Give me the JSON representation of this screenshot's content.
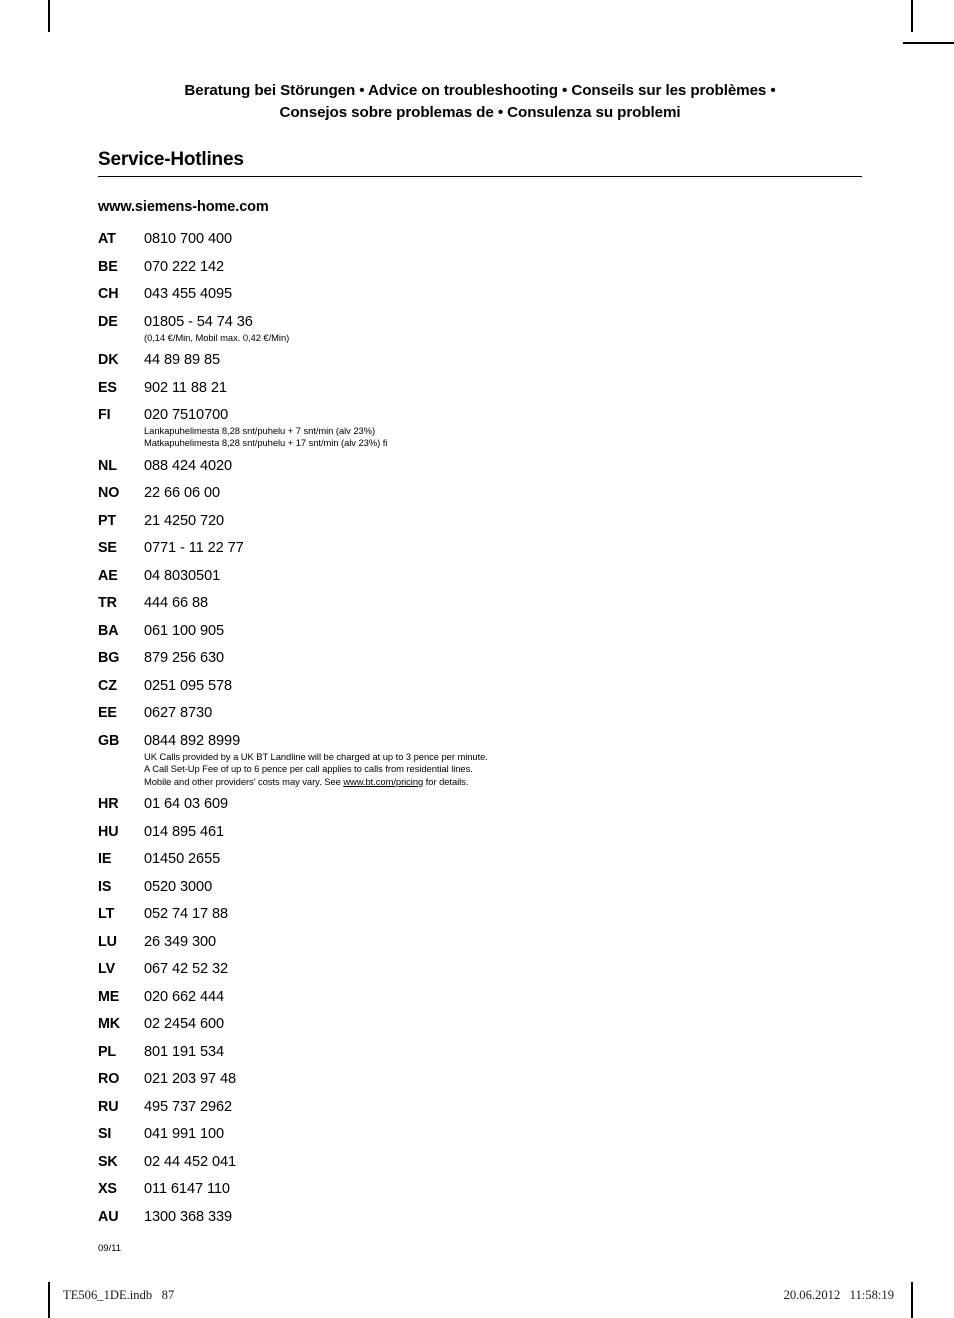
{
  "header": {
    "languages": [
      "Beratung bei Störungen",
      "Advice on troubleshooting",
      "Conseils sur les problèmes",
      "Consejos sobre problemas de",
      "Consulenza su problemi"
    ],
    "separator": "•",
    "line1": "Beratung bei Störungen  •  Advice on troubleshooting  •  Conseils sur les problèmes  •",
    "line2": "Consejos sobre problemas de  •  Consulenza su problemi"
  },
  "section": {
    "title": "Service-Hotlines",
    "website": "www.siemens-home.com"
  },
  "hotlines": [
    {
      "code": "AT",
      "number": "0810 700 400",
      "notes": []
    },
    {
      "code": "BE",
      "number": "070 222 142",
      "notes": []
    },
    {
      "code": "CH",
      "number": "043 455 4095",
      "notes": []
    },
    {
      "code": "DE",
      "number": "01805 - 54 74 36",
      "notes": [
        "(0,14 €/Min, Mobil max. 0,42 €/Min)"
      ]
    },
    {
      "code": "DK",
      "number": "44 89 89 85",
      "notes": []
    },
    {
      "code": "ES",
      "number": "902 11 88 21",
      "notes": []
    },
    {
      "code": "FI",
      "number": "020 7510700",
      "notes": [
        "Lankapuhelimesta 8,28 snt/puhelu + 7 snt/min (alv 23%)",
        "Matkapuhelimesta 8,28 snt/puhelu + 17 snt/min (alv 23%) fi"
      ]
    },
    {
      "code": "NL",
      "number": "088 424 4020",
      "notes": []
    },
    {
      "code": "NO",
      "number": "22 66 06 00",
      "notes": []
    },
    {
      "code": "PT",
      "number": "21 4250 720",
      "notes": []
    },
    {
      "code": "SE",
      "number": "0771 - 11 22 77",
      "notes": []
    },
    {
      "code": "AE",
      "number": "04 8030501",
      "notes": []
    },
    {
      "code": "TR",
      "number": "444 66 88",
      "notes": []
    },
    {
      "code": "BA",
      "number": "061 100 905",
      "notes": []
    },
    {
      "code": "BG",
      "number": "879 256 630",
      "notes": []
    },
    {
      "code": "CZ",
      "number": "0251 095 578",
      "notes": []
    },
    {
      "code": "EE",
      "number": "0627 8730",
      "notes": []
    },
    {
      "code": "GB",
      "number": "0844 892 8999",
      "notes": [
        "UK Calls provided by a UK BT Landline will be charged at up to 3 pence per minute.",
        "A Call Set-Up Fee of up to 6 pence per call applies to calls from residential lines."
      ],
      "note_link": {
        "prefix": "Mobile and other providers' costs may vary. See ",
        "link": "www.bt.com/pricing",
        "suffix": " for details."
      }
    },
    {
      "code": "HR",
      "number": "01 64 03 609",
      "notes": []
    },
    {
      "code": "HU",
      "number": "014 895 461",
      "notes": []
    },
    {
      "code": "IE",
      "number": "01450 2655",
      "notes": []
    },
    {
      "code": "IS",
      "number": "0520 3000",
      "notes": []
    },
    {
      "code": "LT",
      "number": "052 74 17 88",
      "notes": []
    },
    {
      "code": "LU",
      "number": "26 349 300",
      "notes": []
    },
    {
      "code": "LV",
      "number": "067 42 52 32",
      "notes": []
    },
    {
      "code": "ME",
      "number": "020 662 444",
      "notes": []
    },
    {
      "code": "MK",
      "number": "02 2454 600",
      "notes": []
    },
    {
      "code": "PL",
      "number": "801 191 534",
      "notes": []
    },
    {
      "code": "RO",
      "number": "021 203 97 48",
      "notes": []
    },
    {
      "code": "RU",
      "number": "495 737 2962",
      "notes": []
    },
    {
      "code": "SI",
      "number": "041 991 100",
      "notes": []
    },
    {
      "code": "SK",
      "number": "02 44 452 041",
      "notes": []
    },
    {
      "code": "XS",
      "number": "011 6147 110",
      "notes": []
    },
    {
      "code": "AU",
      "number": "1300 368 339",
      "notes": []
    }
  ],
  "footer": {
    "revision": "09/11",
    "print_file": "TE506_1DE.indb   87",
    "print_timestamp": "20.06.2012   11:58:19"
  }
}
